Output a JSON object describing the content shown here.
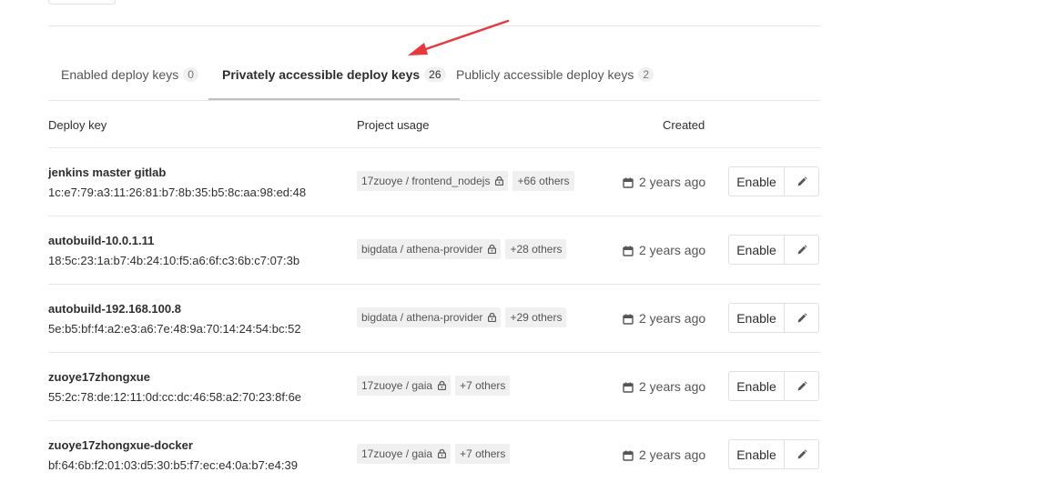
{
  "tabs": [
    {
      "label": "Enabled deploy keys",
      "count": "0",
      "active": false
    },
    {
      "label": "Privately accessible deploy keys",
      "count": "26",
      "active": true
    },
    {
      "label": "Publicly accessible deploy keys",
      "count": "2",
      "active": false
    }
  ],
  "table": {
    "headers": {
      "deploy_key": "Deploy key",
      "project_usage": "Project usage",
      "created": "Created"
    },
    "rows": [
      {
        "title": "jenkins master gitlab",
        "fingerprint": "1c:e7:79:a3:11:26:81:b7:8b:35:b5:8c:aa:98:ed:48",
        "project": "17zuoye / frontend_nodejs",
        "others": "+66 others",
        "created": "2 years ago",
        "enable_label": "Enable"
      },
      {
        "title": "autobuild-10.0.1.11",
        "fingerprint": "18:5c:23:1a:b7:4b:24:10:f5:a6:6f:c3:6b:c7:07:3b",
        "project": "bigdata / athena-provider",
        "others": "+28 others",
        "created": "2 years ago",
        "enable_label": "Enable"
      },
      {
        "title": "autobuild-192.168.100.8",
        "fingerprint": "5e:b5:bf:f4:a2:e3:a6:7e:48:9a:70:14:24:54:bc:52",
        "project": "bigdata / athena-provider",
        "others": "+29 others",
        "created": "2 years ago",
        "enable_label": "Enable"
      },
      {
        "title": "zuoye17zhongxue",
        "fingerprint": "55:2c:78:de:12:11:0d:cc:dc:46:58:a2:70:23:8f:6e",
        "project": "17zuoye / gaia",
        "others": "+7 others",
        "created": "2 years ago",
        "enable_label": "Enable"
      },
      {
        "title": "zuoye17zhongxue-docker",
        "fingerprint": "bf:64:6b:f2:01:03:d5:30:b5:f7:ec:e4:0a:b7:e4:39",
        "project": "17zuoye / gaia",
        "others": "+7 others",
        "created": "2 years ago",
        "enable_label": "Enable"
      }
    ]
  },
  "colors": {
    "annotation_arrow": "#e8383d",
    "badge_bg": "#f0f0f0",
    "border": "#e5e5e5"
  },
  "icons": {
    "lock": "lock-icon",
    "calendar": "calendar-icon",
    "pencil": "pencil-icon"
  }
}
